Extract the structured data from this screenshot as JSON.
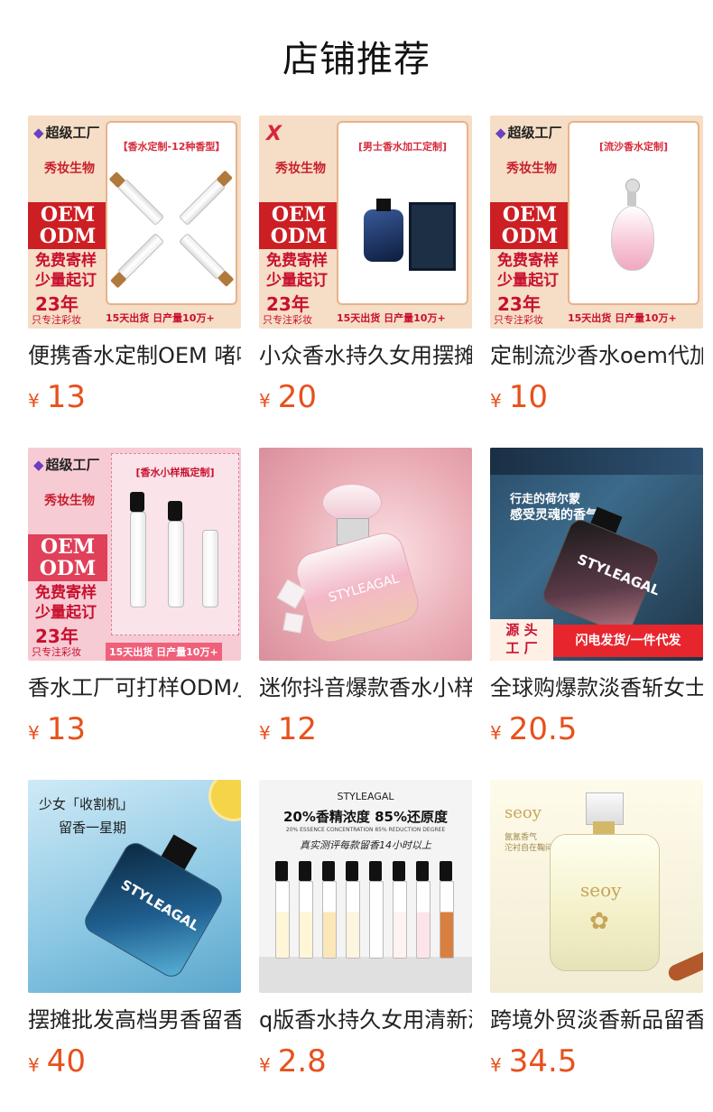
{
  "page": {
    "title": "店铺推荐"
  },
  "colors": {
    "price": "#e8501c",
    "title": "#111111"
  },
  "products": [
    {
      "name": "便携香水定制OEM 啫喱香水代加工",
      "currency": "¥",
      "price": "13",
      "thumb": {
        "logo": "超级工厂",
        "panel_title": "【香水定制-12种香型】",
        "oem": "OEM",
        "odm": "ODM",
        "line1": "免费寄样",
        "line2": "少量起订",
        "year": "23年",
        "only": "只专注彩妆",
        "bottom": "15天出货  日产量10万+",
        "sub": "秀妆生物"
      }
    },
    {
      "name": "小众香水持久女用摆摊批发",
      "currency": "¥",
      "price": "20",
      "thumb": {
        "logo": "X",
        "panel_title": "[男士香水加工定制]",
        "oem": "OEM",
        "odm": "ODM",
        "line1": "免费寄样",
        "line2": "少量起订",
        "year": "23年",
        "only": "只专注彩妆",
        "bottom": "15天出货  日产量10万+",
        "sub": "秀妆生物"
      }
    },
    {
      "name": "定制流沙香水oem代加工",
      "currency": "¥",
      "price": "10",
      "thumb": {
        "logo": "超级工厂",
        "panel_title": "[流沙香水定制]",
        "oem": "OEM",
        "odm": "ODM",
        "line1": "免费寄样",
        "line2": "少量起订",
        "year": "23年",
        "only": "只专注彩妆",
        "bottom": "15天出货  日产量10万+",
        "sub": "秀妆生物"
      }
    },
    {
      "name": "香水工厂可打样ODM小样瓶",
      "currency": "¥",
      "price": "13",
      "thumb": {
        "logo": "超级工厂",
        "panel_title": "[香水小样瓶定制]",
        "oem": "OEM",
        "odm": "ODM",
        "line1": "免费寄样",
        "line2": "少量起订",
        "year": "23年",
        "only": "只专注彩妆",
        "bottom": "15天出货 日产量10万+",
        "sub": "秀妆生物"
      }
    },
    {
      "name": "迷你抖音爆款香水小样",
      "currency": "¥",
      "price": "12",
      "thumb": {
        "bottle_text": "STYLEAGAL"
      }
    },
    {
      "name": "全球购爆款淡香斩女士香水",
      "currency": "¥",
      "price": "20.5",
      "thumb": {
        "line1": "行走的荷尔蒙",
        "line2": "感受灵魂的香气",
        "bottle_text": "STYLEAGAL",
        "tag1": "源 头",
        "tag2": "工 厂",
        "banner": "闪电发货/一件代发"
      }
    },
    {
      "name": "摆摊批发高档男香留香持久",
      "currency": "¥",
      "price": "40",
      "thumb": {
        "line1": "少女「收割机」",
        "line2": "留香一星期",
        "bottle_text": "STYLEAGAL"
      }
    },
    {
      "name": "q版香水持久女用清新淡香",
      "currency": "¥",
      "price": "2.8",
      "thumb": {
        "brand": "STYLEAGAL",
        "headline": "20%香精浓度  85%还原度",
        "sub": "20% ESSENCE CONCENTRATION 85% REDUCTION DEGREE",
        "review": "真实测评每款留香14小时以上"
      }
    },
    {
      "name": "跨境外贸淡香新品留香持久",
      "currency": "¥",
      "price": "34.5",
      "thumb": {
        "brand": "seoy",
        "sub1": "氤氲香气",
        "sub2": "沱衬自在鞠间",
        "bottle_text": "seoy"
      }
    }
  ]
}
